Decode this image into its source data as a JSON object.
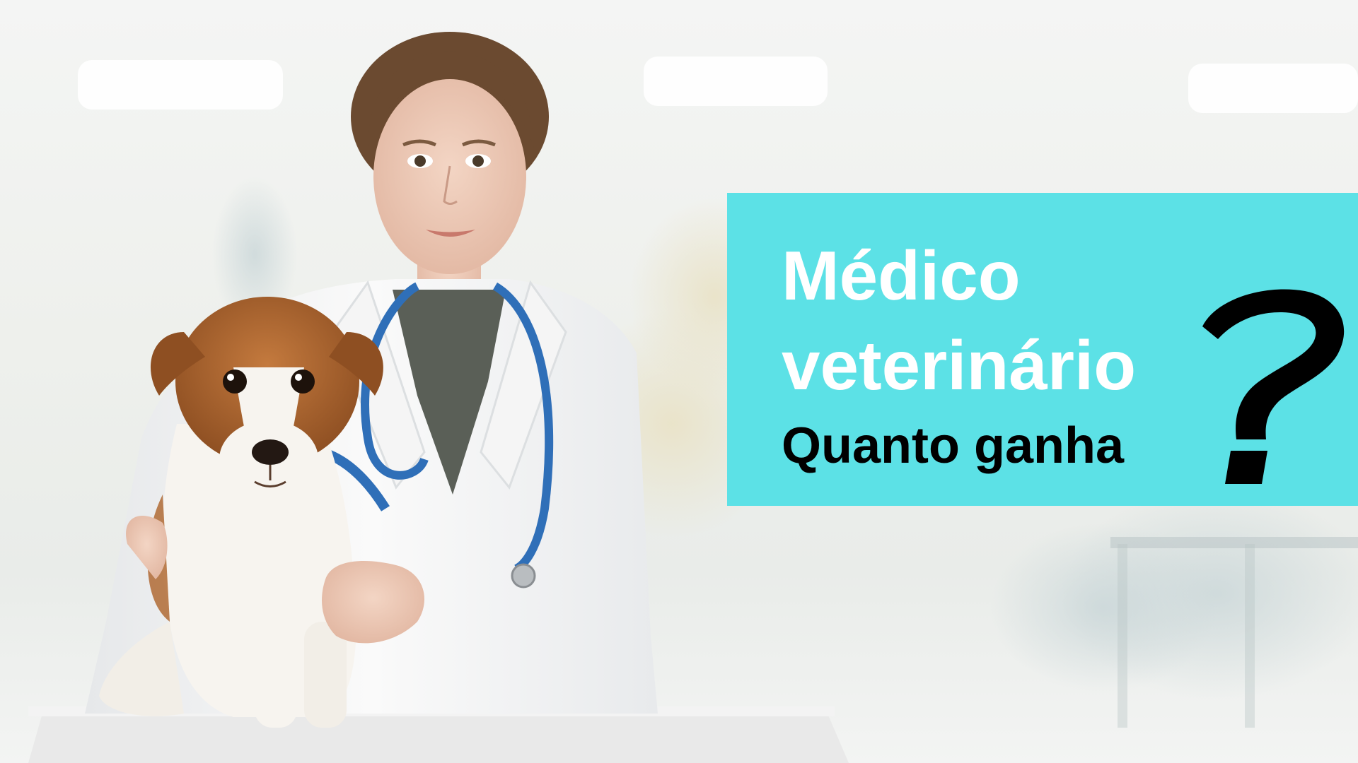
{
  "banner": {
    "line1": "Médico",
    "line2": "veterinário",
    "line3": "Quanto ganha",
    "background_color": "#5ce1e6",
    "title_color": "#ffffff",
    "subtitle_color": "#000000"
  },
  "icons": {
    "question_mark": "question-mark-icon"
  }
}
